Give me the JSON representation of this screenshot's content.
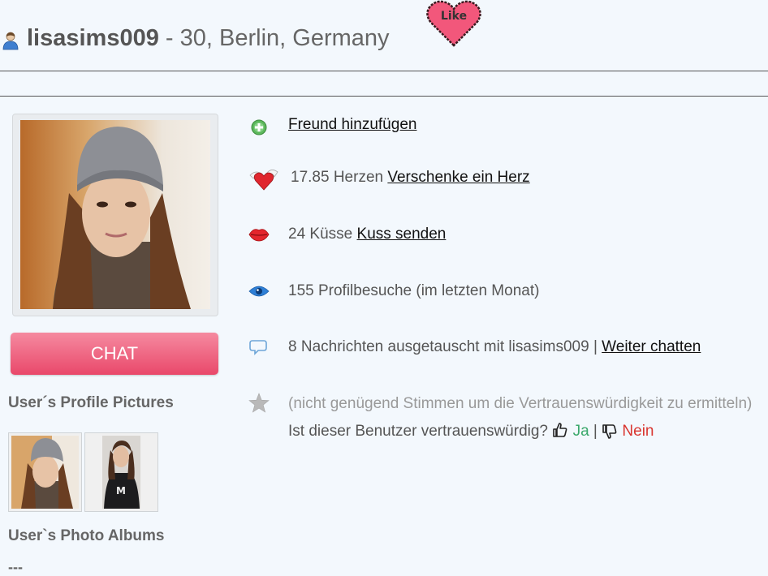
{
  "header": {
    "username": "lisasims009",
    "details": " - 30, Berlin, Germany",
    "like_label": "Like"
  },
  "sidebar": {
    "chat_label": "CHAT",
    "pictures_heading": "User´s Profile Pictures",
    "albums_heading": "User`s Photo Albums",
    "albums_empty": "---"
  },
  "info": {
    "add_friend_link": "Freund hinzufügen",
    "hearts_text": "17.85 Herzen",
    "hearts_link": "Verschenke ein Herz",
    "kisses_text": "24 Küsse",
    "kisses_link": "Kuss senden",
    "visits_text": "155 Profilbesuche (im letzten Monat)",
    "messages_text": "8 Nachrichten ausgetauscht mit lisasims009 |",
    "messages_link": "Weiter chatten",
    "trust_note": "(nicht genügend Stimmen um die Vertrauenswürdigkeit zu ermitteln)",
    "trust_question": "Ist dieser Benutzer vertrauenswürdig?",
    "yes_label": "Ja",
    "separator": "|",
    "no_label": "Nein"
  },
  "colors": {
    "background": "#f3f8fd",
    "chat_button": "#e9486a",
    "yes": "#3aa86b",
    "no": "#d9352f"
  },
  "icons": [
    "user-icon",
    "like-heart-icon",
    "add-friend-icon",
    "winged-heart-icon",
    "lips-icon",
    "eye-icon",
    "speech-bubble-icon",
    "star-icon",
    "thumbs-up-icon",
    "thumbs-down-icon"
  ]
}
